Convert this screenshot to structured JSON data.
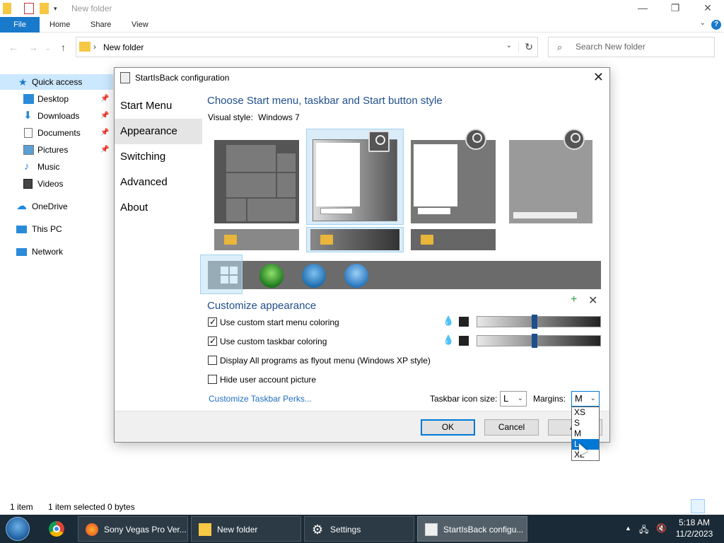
{
  "explorer": {
    "title": "New folder",
    "window_controls": {
      "minimize": "—",
      "maximize": "❐",
      "close": "✕"
    },
    "ribbon": {
      "file": "File",
      "home": "Home",
      "share": "Share",
      "view": "View",
      "help": "?"
    },
    "address": {
      "path": "New folder"
    },
    "search": {
      "placeholder": "Search New folder"
    },
    "nav": [
      {
        "label": "Quick access",
        "icon": "star-icon",
        "color": "#1979ca"
      },
      {
        "label": "Desktop",
        "icon": "desktop-icon",
        "color": "#2b8ad9"
      },
      {
        "label": "Downloads",
        "icon": "download-icon",
        "color": "#2b8ad9"
      },
      {
        "label": "Documents",
        "icon": "document-icon",
        "color": "#777777"
      },
      {
        "label": "Pictures",
        "icon": "pictures-icon",
        "color": "#5aa0d8"
      },
      {
        "label": "Music",
        "icon": "music-icon",
        "color": "#2b8ad9"
      },
      {
        "label": "Videos",
        "icon": "video-icon",
        "color": "#444444"
      },
      {
        "label": "OneDrive",
        "icon": "cloud-icon",
        "color": "#1e88e5"
      },
      {
        "label": "This PC",
        "icon": "computer-icon",
        "color": "#2b8ad9"
      },
      {
        "label": "Network",
        "icon": "network-icon",
        "color": "#2b8ad9"
      }
    ],
    "status": {
      "items": "1 item",
      "selected": "1 item selected",
      "size": "0 bytes"
    }
  },
  "dialog": {
    "title": "StartIsBack configuration",
    "nav": [
      "Start Menu",
      "Appearance",
      "Switching",
      "Advanced",
      "About"
    ],
    "selected_nav": "Appearance",
    "style_heading": "Choose Start menu, taskbar and Start button style",
    "visual_style_label": "Visual style:",
    "visual_style_value": "Windows 7",
    "customize_heading": "Customize appearance",
    "options": [
      {
        "label": "Use custom start menu coloring",
        "checked": true
      },
      {
        "label": "Use custom taskbar coloring",
        "checked": true
      },
      {
        "label": "Display All programs as flyout menu (Windows XP style)",
        "checked": false
      },
      {
        "label": "Hide user account picture",
        "checked": false
      }
    ],
    "start_menu_slider": 0.46,
    "taskbar_slider": 0.46,
    "link": "Customize Taskbar Perks...",
    "taskbar_icon_size_label": "Taskbar icon size:",
    "taskbar_icon_size_value": "L",
    "margins_label": "Margins:",
    "margins_value": "M",
    "margins_options": [
      "XS",
      "S",
      "M",
      "L",
      "XL"
    ],
    "margins_highlighted": "L",
    "ok": "OK",
    "cancel": "Cancel",
    "apply": "Apply",
    "apply_visible": "Ap",
    "accent": "#1f4e8c"
  },
  "taskbar": {
    "tasks": [
      {
        "label": "Sony Vegas Pro Ver...",
        "icon": "firefox-icon"
      },
      {
        "label": "New folder",
        "icon": "folder-icon"
      },
      {
        "label": "Settings",
        "icon": "gear-icon"
      },
      {
        "label": "StartIsBack configu...",
        "icon": "config-icon"
      }
    ],
    "time": "5:18 AM",
    "date": "11/2/2023"
  }
}
